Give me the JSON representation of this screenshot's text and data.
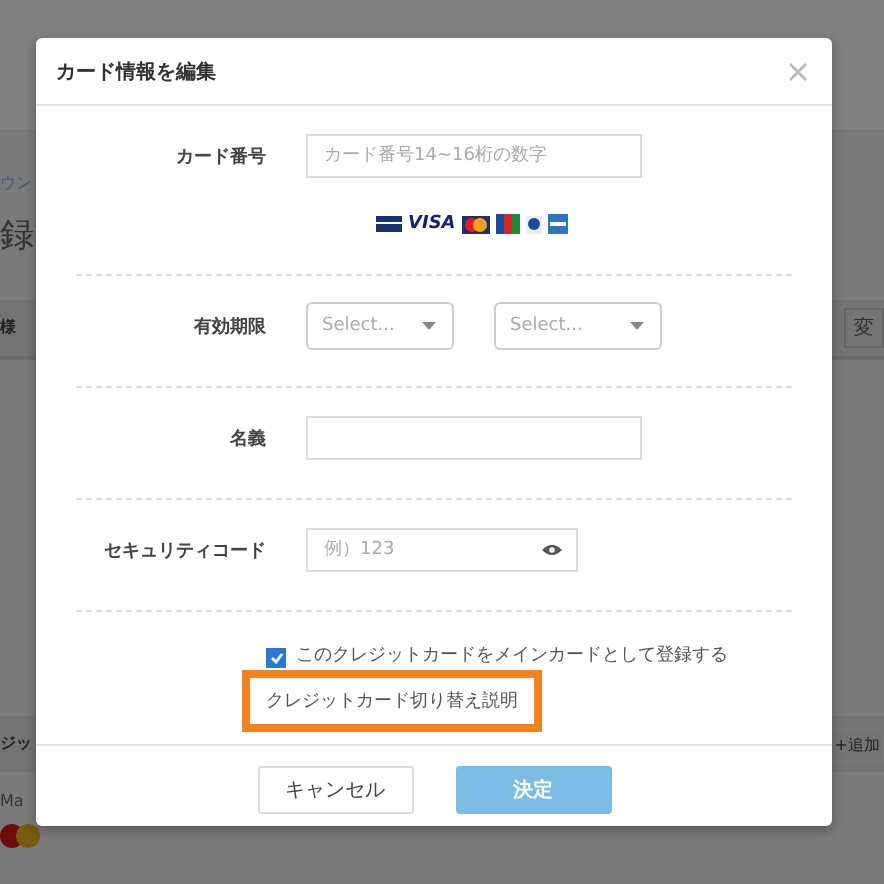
{
  "background_page": {
    "breadcrumb": "ウン",
    "heading": "録",
    "section_title": "様",
    "change_button": "変",
    "card_section_title": "ジッ",
    "add_button": "+追加",
    "card_brand": "Ma"
  },
  "dialog": {
    "title": "カード情報を編集",
    "card_number": {
      "label": "カード番号",
      "placeholder": "カード番号14~16桁の数字",
      "visa_logo": "VISA"
    },
    "expiry": {
      "label": "有効期限",
      "selects": [
        {
          "placeholder": "Select..."
        },
        {
          "placeholder": "Select..."
        }
      ]
    },
    "name": {
      "label": "名義"
    },
    "security_code": {
      "label": "セキュリティコード",
      "placeholder": "例）123"
    },
    "main_card": {
      "label": "このクレジットカードをメインカードとして登録する",
      "checked": true
    },
    "switch_help": {
      "label": "クレジットカード切り替え説明",
      "highlighted": true
    },
    "buttons": [
      {
        "label": "キャンセル",
        "kind": "secondary"
      },
      {
        "label": "決定",
        "kind": "primary"
      }
    ]
  }
}
